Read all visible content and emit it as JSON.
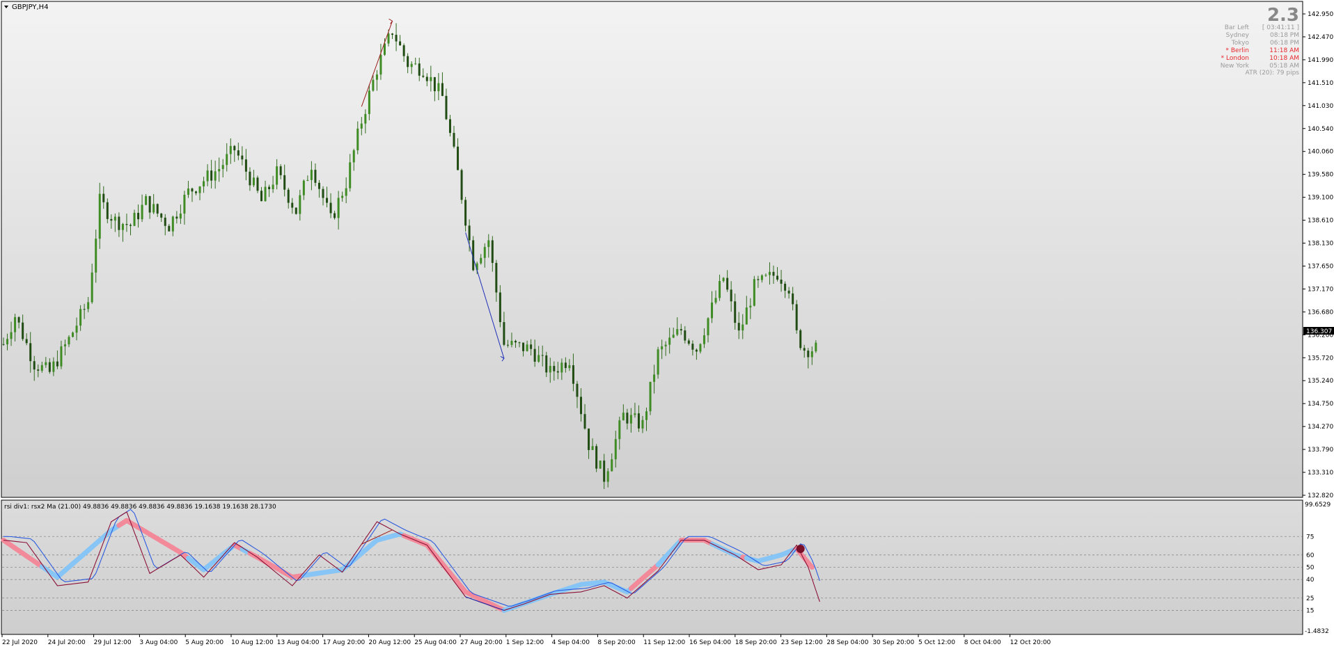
{
  "window": {
    "symbol_label": "GBPJPY,H4"
  },
  "info_panel": {
    "spread": "2.3",
    "rows": [
      {
        "label": "Bar Left",
        "value": "[ 03:41:11 ]",
        "color": "#9a9a9a"
      },
      {
        "label": "Sydney",
        "value": "08:18 PM",
        "color": "#9a9a9a"
      },
      {
        "label": "Tokyo",
        "value": "06:18 PM",
        "color": "#9a9a9a"
      },
      {
        "label": "* Berlin",
        "value": "11:18 AM",
        "color": "#e8262b"
      },
      {
        "label": "* London",
        "value": "10:18 AM",
        "color": "#e8262b"
      },
      {
        "label": "New York",
        "value": "05:18 AM",
        "color": "#9a9a9a"
      }
    ],
    "atr": "ATR (20): 79 pips"
  },
  "price_axis": {
    "labels": [
      "142.950",
      "142.470",
      "141.990",
      "141.510",
      "141.030",
      "140.540",
      "140.060",
      "139.580",
      "139.100",
      "138.610",
      "138.130",
      "137.650",
      "137.170",
      "136.680",
      "136.200",
      "135.720",
      "135.240",
      "134.750",
      "134.270",
      "133.790",
      "133.310",
      "132.820"
    ],
    "current_price": "136.307"
  },
  "indicator": {
    "header": "rsi div1: rsx2 Ma (21.00) 49.8836 49.8836 49.8836 49.8836 19.1638 19.1638 28.1730",
    "levels": [
      "75",
      "60",
      "50",
      "40",
      "25",
      "15"
    ],
    "max_label": "99.6529",
    "min_label": "-1.4832"
  },
  "time_axis": {
    "labels": [
      "22 Jul 2020",
      "24 Jul 20:00",
      "29 Jul 12:00",
      "3 Aug 04:00",
      "5 Aug 20:00",
      "10 Aug 12:00",
      "13 Aug 04:00",
      "17 Aug 20:00",
      "20 Aug 12:00",
      "25 Aug 04:00",
      "27 Aug 20:00",
      "1 Sep 12:00",
      "4 Sep 04:00",
      "8 Sep 20:00",
      "11 Sep 12:00",
      "16 Sep 04:00",
      "18 Sep 20:00",
      "23 Sep 12:00",
      "28 Sep 04:00",
      "30 Sep 20:00",
      "5 Oct 12:00",
      "8 Oct 04:00",
      "12 Oct 20:00"
    ]
  },
  "colors": {
    "candle": "#2f6b1c",
    "rsi_fast": "#8b1036",
    "rsi_slow": "#2c5be0",
    "ma_up": "#86c5f5",
    "ma_down": "#f28a9a",
    "bearish_div": "#9b1c1c",
    "bullish_div": "#1f2fb8"
  },
  "chart_data": {
    "type": "candlestick",
    "title": "GBPJPY,H4",
    "ylim": [
      132.82,
      142.95
    ],
    "price_path": {
      "bars": 265,
      "pivots": [
        [
          0,
          136.0
        ],
        [
          3,
          136.6
        ],
        [
          8,
          135.6
        ],
        [
          12,
          135.4
        ],
        [
          17,
          136.1
        ],
        [
          22,
          136.9
        ],
        [
          25,
          139.0
        ],
        [
          29,
          138.6
        ],
        [
          33,
          138.5
        ],
        [
          37,
          139.0
        ],
        [
          43,
          138.5
        ],
        [
          48,
          139.2
        ],
        [
          56,
          139.7
        ],
        [
          60,
          140.1
        ],
        [
          64,
          139.5
        ],
        [
          67,
          139.0
        ],
        [
          71,
          139.6
        ],
        [
          76,
          138.8
        ],
        [
          80,
          139.8
        ],
        [
          85,
          138.6
        ],
        [
          89,
          139.4
        ],
        [
          93,
          140.7
        ],
        [
          97,
          141.8
        ],
        [
          101,
          142.6
        ],
        [
          105,
          141.9
        ],
        [
          109,
          141.8
        ],
        [
          114,
          141.2
        ],
        [
          118,
          139.6
        ],
        [
          122,
          137.7
        ],
        [
          126,
          138.2
        ],
        [
          130,
          136.0
        ],
        [
          137,
          135.9
        ],
        [
          142,
          135.4
        ],
        [
          147,
          135.7
        ],
        [
          152,
          133.9
        ],
        [
          156,
          133.2
        ],
        [
          161,
          134.5
        ],
        [
          166,
          134.3
        ],
        [
          170,
          135.8
        ],
        [
          176,
          136.3
        ],
        [
          180,
          135.9
        ],
        [
          187,
          137.4
        ],
        [
          191,
          136.2
        ],
        [
          195,
          137.2
        ],
        [
          201,
          137.5
        ],
        [
          204,
          137.2
        ],
        [
          206,
          136.2
        ],
        [
          208,
          135.9
        ]
      ]
    },
    "rsi_path": [
      [
        0,
        72
      ],
      [
        6,
        70
      ],
      [
        14,
        35
      ],
      [
        22,
        38
      ],
      [
        28,
        87
      ],
      [
        32,
        95
      ],
      [
        38,
        45
      ],
      [
        46,
        60
      ],
      [
        52,
        42
      ],
      [
        60,
        70
      ],
      [
        66,
        58
      ],
      [
        75,
        35
      ],
      [
        82,
        60
      ],
      [
        88,
        46
      ],
      [
        97,
        87
      ],
      [
        103,
        77
      ],
      [
        110,
        68
      ],
      [
        120,
        26
      ],
      [
        130,
        15
      ],
      [
        135,
        20
      ],
      [
        142,
        28
      ],
      [
        150,
        30
      ],
      [
        156,
        35
      ],
      [
        162,
        25
      ],
      [
        170,
        47
      ],
      [
        176,
        72
      ],
      [
        182,
        72
      ],
      [
        190,
        60
      ],
      [
        196,
        48
      ],
      [
        202,
        52
      ],
      [
        206,
        68
      ],
      [
        209,
        50
      ],
      [
        212,
        22
      ]
    ],
    "ma_path": [
      [
        0,
        72
      ],
      [
        14,
        42
      ],
      [
        28,
        80
      ],
      [
        32,
        88
      ],
      [
        46,
        62
      ],
      [
        52,
        48
      ],
      [
        60,
        68
      ],
      [
        66,
        58
      ],
      [
        75,
        42
      ],
      [
        88,
        48
      ],
      [
        97,
        72
      ],
      [
        103,
        77
      ],
      [
        110,
        68
      ],
      [
        120,
        30
      ],
      [
        130,
        15
      ],
      [
        142,
        28
      ],
      [
        150,
        36
      ],
      [
        156,
        38
      ],
      [
        162,
        30
      ],
      [
        170,
        52
      ],
      [
        176,
        72
      ],
      [
        182,
        72
      ],
      [
        190,
        60
      ],
      [
        196,
        55
      ],
      [
        202,
        60
      ],
      [
        206,
        65
      ],
      [
        210,
        50
      ]
    ],
    "ma_color_switch": [
      [
        0,
        "down"
      ],
      [
        10,
        "up"
      ],
      [
        30,
        "down"
      ],
      [
        48,
        "up"
      ],
      [
        60,
        "down"
      ],
      [
        62,
        "up"
      ],
      [
        64,
        "down"
      ],
      [
        78,
        "up"
      ],
      [
        104,
        "down"
      ],
      [
        130,
        "up"
      ],
      [
        163,
        "down"
      ],
      [
        170,
        "up"
      ],
      [
        176,
        "down"
      ],
      [
        184,
        "up"
      ],
      [
        192,
        "down"
      ],
      [
        193,
        "up"
      ],
      [
        206,
        "down"
      ]
    ],
    "divergences": [
      {
        "type": "bearish",
        "x_from": 93,
        "x_to": 101
      },
      {
        "type": "bullish",
        "x_from": 120,
        "x_to": 130
      }
    ]
  }
}
